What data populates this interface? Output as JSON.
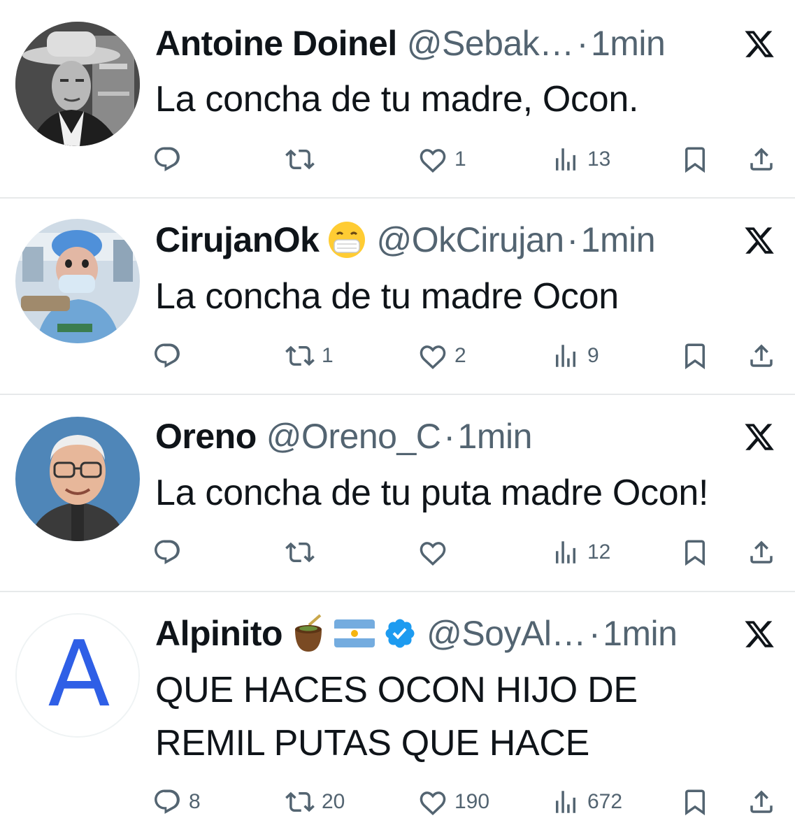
{
  "tweets": [
    {
      "name": "Antoine Doinel",
      "handle": "@Sebak…",
      "dot": "·",
      "time": "1min",
      "text": "La concha de tu madre, Ocon.",
      "replies": "",
      "retweets": "",
      "likes": "1",
      "views": "13"
    },
    {
      "name": "CirujanOk",
      "handle": "@OkCirujan",
      "dot": "·",
      "time": "1min",
      "text": "La concha de tu madre Ocon",
      "replies": "",
      "retweets": "1",
      "likes": "2",
      "views": "9"
    },
    {
      "name": "Oreno",
      "handle": "@Oreno_C",
      "dot": "·",
      "time": "1min",
      "text": "La concha de tu puta madre Ocon!",
      "replies": "",
      "retweets": "",
      "likes": "",
      "views": "12"
    },
    {
      "name": "Alpinito",
      "handle": "@SoyAl…",
      "dot": "·",
      "time": "1min",
      "text_line1": "QUE HACES OCON HIJO DE",
      "text_line2": "REMIL PUTAS QUE HACE",
      "replies": "8",
      "retweets": "20",
      "likes": "190",
      "views": "672"
    }
  ],
  "avatar_letter": "A",
  "colors": {
    "text": "#0f1419",
    "muted": "#536471",
    "divider": "#e7e9ea",
    "verified": "#1d9bf0",
    "letter_blue": "#2f5fe6"
  },
  "icons": [
    "x-logo-icon",
    "reply-icon",
    "retweet-icon",
    "like-icon",
    "views-icon",
    "bookmark-icon",
    "share-icon",
    "mask-face-emoji-icon",
    "mate-emoji-icon",
    "argentina-flag-icon",
    "verified-badge-icon"
  ]
}
